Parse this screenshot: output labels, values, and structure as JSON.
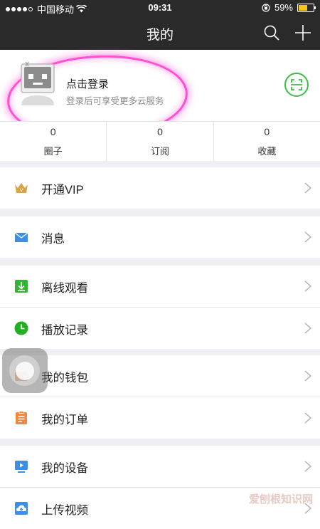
{
  "status_bar": {
    "carrier": "中国移动",
    "time": "09:31",
    "battery_percent": "59%",
    "battery_level": 0.59
  },
  "header": {
    "title": "我的"
  },
  "profile": {
    "login_title": "点击登录",
    "login_subtitle": "登录后可享受更多云服务"
  },
  "stats": [
    {
      "count": "0",
      "label": "圈子"
    },
    {
      "count": "0",
      "label": "订阅"
    },
    {
      "count": "0",
      "label": "收藏"
    }
  ],
  "menu": {
    "vip": "开通VIP",
    "messages": "消息",
    "offline": "离线观看",
    "history": "播放记录",
    "wallet": "我的钱包",
    "orders": "我的订单",
    "devices": "我的设备",
    "upload": "上传视频"
  },
  "watermark": "爱刨根知识网",
  "colors": {
    "accent_green": "#3cbf46",
    "highlight_pink": "#ff4fd2",
    "nav_bg": "#2a2a2a"
  }
}
